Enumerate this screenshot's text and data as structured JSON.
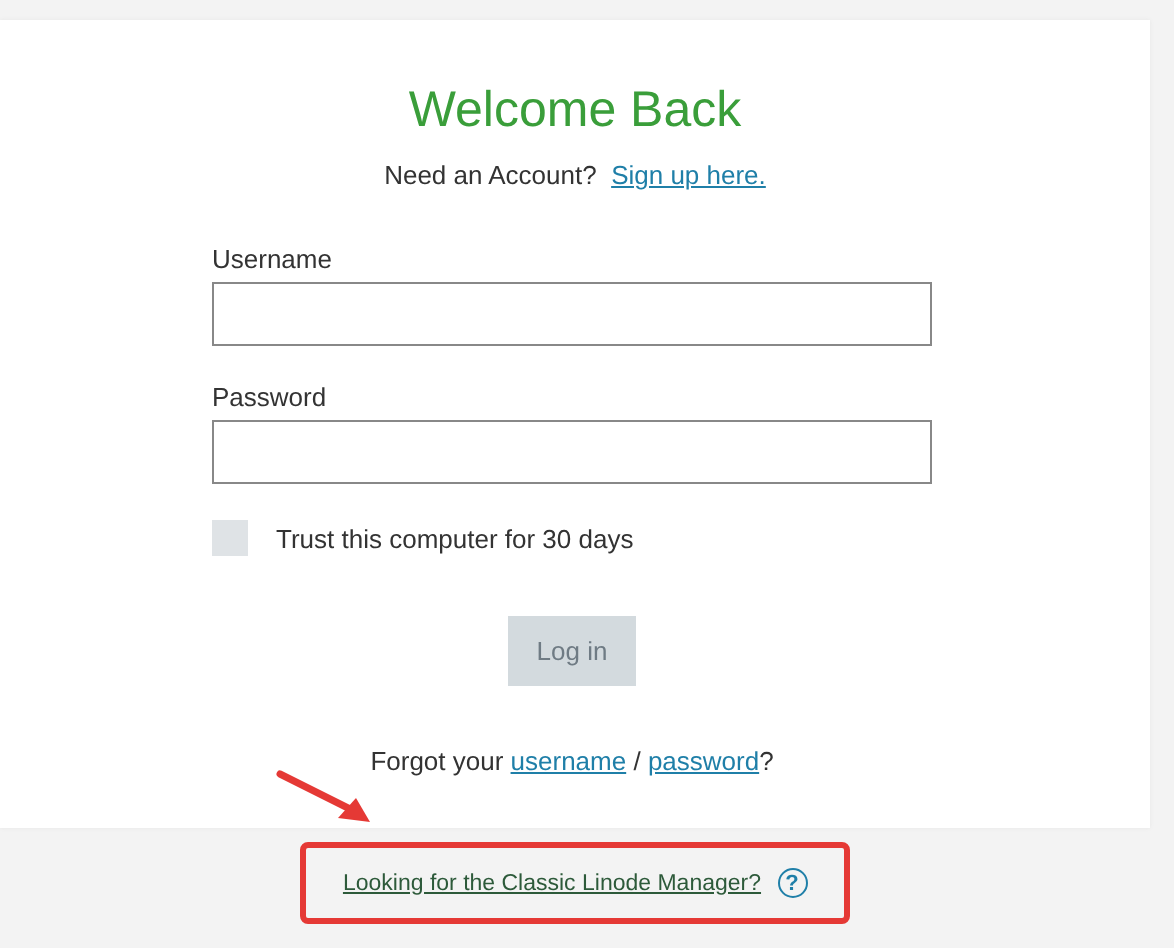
{
  "title": "Welcome Back",
  "signup": {
    "prompt": "Need an Account?",
    "link": "Sign up here."
  },
  "fields": [
    {
      "label": "Username"
    },
    {
      "label": "Password"
    }
  ],
  "trust": {
    "label": "Trust this computer for 30 days",
    "checked": false
  },
  "login_button": {
    "label": "Log in",
    "disabled": true
  },
  "forgot": {
    "prefix": "Forgot your",
    "username_link": "username",
    "separator": "/",
    "password_link": "password",
    "suffix": "?"
  },
  "footer": {
    "link": "Looking for the Classic Linode Manager?",
    "help_icon": "?"
  }
}
